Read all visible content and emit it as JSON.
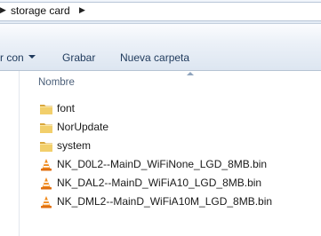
{
  "address_bar": {
    "path_label": "storage card",
    "separator_icon": "chevron-right-icon"
  },
  "toolbar": {
    "partial_label": "r con",
    "grabar_label": "Grabar",
    "new_folder_label": "Nueva carpeta"
  },
  "list": {
    "column_header": "Nombre",
    "items": [
      {
        "name": "font",
        "icon": "folder-icon"
      },
      {
        "name": "NorUpdate",
        "icon": "folder-icon"
      },
      {
        "name": "system",
        "icon": "folder-icon"
      },
      {
        "name": "NK_D0L2--MainD_WiFiNone_LGD_8MB.bin",
        "icon": "vlc-cone-icon"
      },
      {
        "name": "NK_DAL2--MainD_WiFiA10_LGD_8MB.bin",
        "icon": "vlc-cone-icon"
      },
      {
        "name": "NK_DML2--MainD_WiFiA10M_LGD_8MB.bin",
        "icon": "vlc-cone-icon"
      }
    ]
  },
  "colors": {
    "toolbar_text": "#1e395b",
    "header_text": "#4c607a",
    "folder_yellow": "#e8c15a",
    "vlc_orange": "#f08a1c"
  }
}
